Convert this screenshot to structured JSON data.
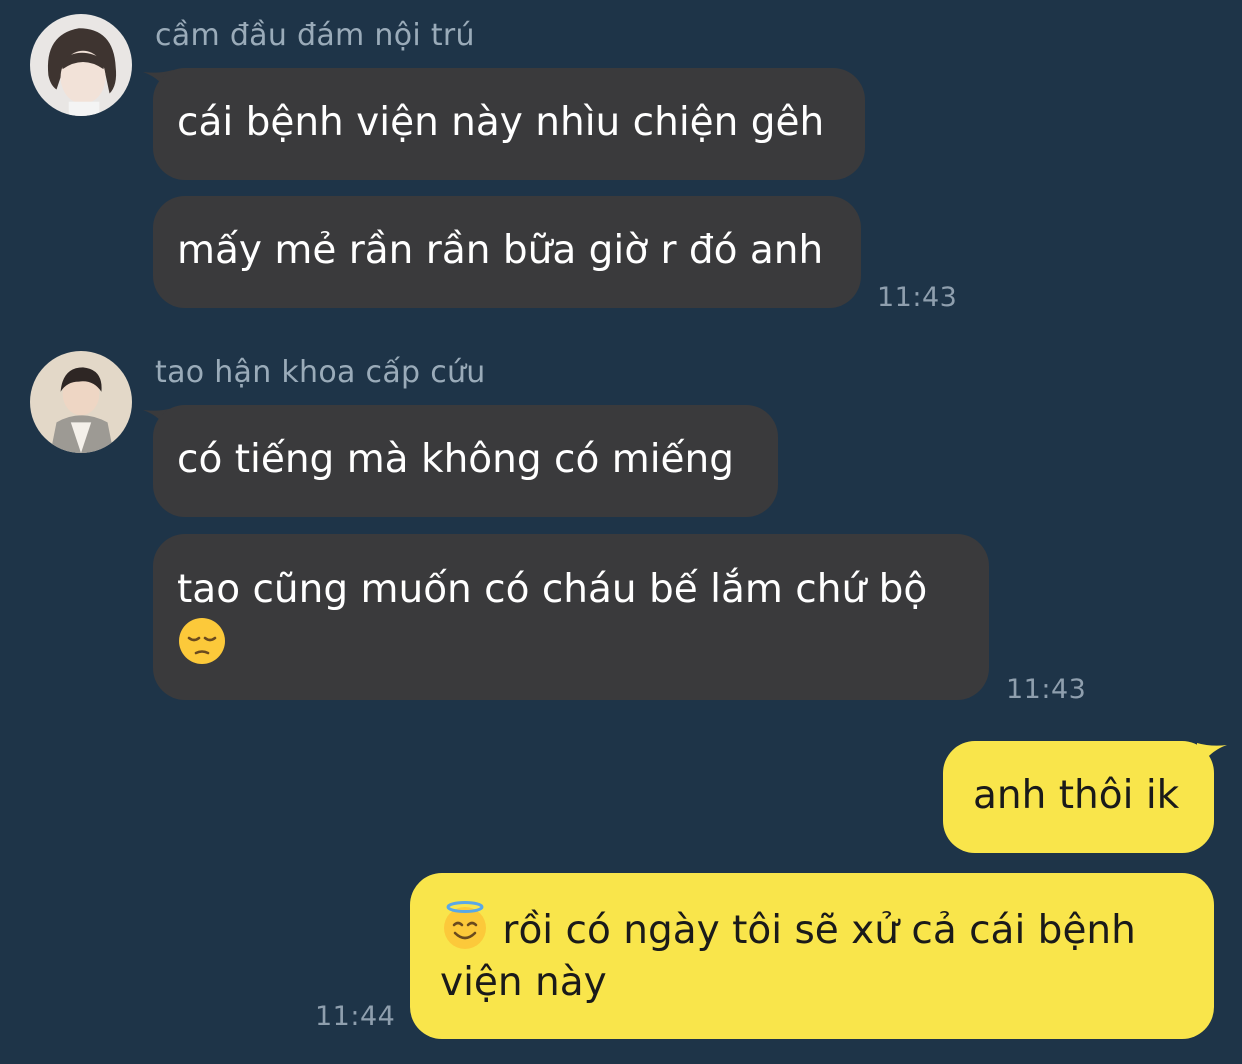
{
  "colors": {
    "background": "#1e3448",
    "incoming_bubble": "#3a3a3c",
    "outgoing_bubble": "#f9e54b",
    "sender_name": "#9aabb9",
    "timestamp": "#8f9fae"
  },
  "messages": [
    {
      "sender": "cầm đầu đám nội trú",
      "avatar": "avatar-icon",
      "bubbles": [
        "cái bệnh viện này nhìu chiện gêh",
        "mấy mẻ rần rần bữa giờ r đó anh"
      ],
      "time": "11:43"
    },
    {
      "sender": "tao hận khoa cấp cứu",
      "avatar": "avatar-icon",
      "bubbles": [
        "có tiếng mà không có miếng",
        "tao cũng muốn có cháu bế lắm chứ bộ"
      ],
      "emoji": "pensive-face-icon",
      "time": "11:43"
    }
  ],
  "outgoing": {
    "bubbles": [
      "anh thôi ik",
      "rồi có ngày tôi sẽ xử cả cái bệnh",
      "viện này"
    ],
    "emoji": "smiling-face-with-halo-icon",
    "time": "11:44"
  }
}
